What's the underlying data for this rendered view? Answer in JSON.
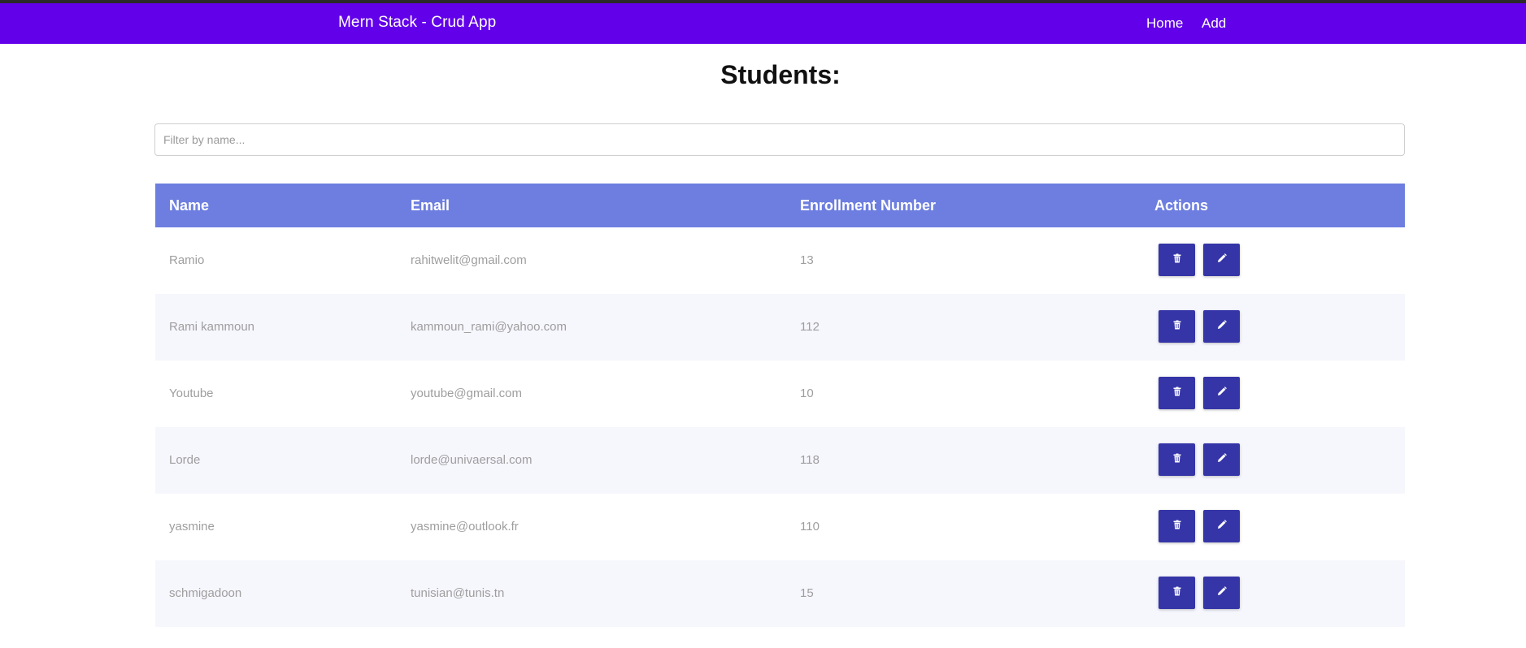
{
  "navbar": {
    "brand": "Mern Stack - Crud App",
    "links": [
      "Home",
      "Add"
    ],
    "color": "#6200ea"
  },
  "page": {
    "title": "Students:"
  },
  "filter": {
    "placeholder": "Filter by name...",
    "value": ""
  },
  "table": {
    "header_color": "#6d7ee0",
    "columns": [
      "Name",
      "Email",
      "Enrollment Number",
      "Actions"
    ],
    "rows": [
      {
        "name": "Ramio",
        "email": "rahitwelit@gmail.com",
        "enrollment": "13"
      },
      {
        "name": "Rami kammoun",
        "email": "kammoun_rami@yahoo.com",
        "enrollment": "112"
      },
      {
        "name": "Youtube",
        "email": "youtube@gmail.com",
        "enrollment": "10"
      },
      {
        "name": "Lorde",
        "email": "lorde@univaersal.com",
        "enrollment": "118"
      },
      {
        "name": "yasmine",
        "email": "yasmine@outlook.fr",
        "enrollment": "110"
      },
      {
        "name": "schmigadoon",
        "email": "tunisian@tunis.tn",
        "enrollment": "15"
      }
    ],
    "row_actions": [
      "trash-icon",
      "pencil-icon"
    ],
    "action_color": "#3535a8"
  }
}
